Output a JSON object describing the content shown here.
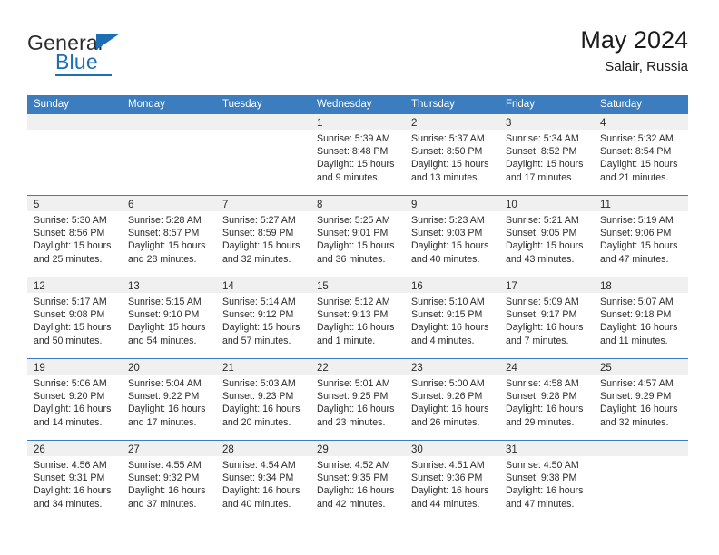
{
  "brand": {
    "name_top": "General",
    "name_bottom": "Blue",
    "triangle_color": "#1c6fb5"
  },
  "header": {
    "title": "May 2024",
    "subtitle": "Salair, Russia"
  },
  "theme": {
    "header_blue": "#3b7dbf",
    "daynum_band": "#f0f0f0",
    "text": "#2b2b2b"
  },
  "weekdays": [
    "Sunday",
    "Monday",
    "Tuesday",
    "Wednesday",
    "Thursday",
    "Friday",
    "Saturday"
  ],
  "labels": {
    "sunrise": "Sunrise:",
    "sunset": "Sunset:",
    "daylight": "Daylight:"
  },
  "weeks": [
    [
      {
        "day": "",
        "lines": []
      },
      {
        "day": "",
        "lines": []
      },
      {
        "day": "",
        "lines": []
      },
      {
        "day": "1",
        "lines": [
          "Sunrise: 5:39 AM",
          "Sunset: 8:48 PM",
          "Daylight: 15 hours and 9 minutes."
        ]
      },
      {
        "day": "2",
        "lines": [
          "Sunrise: 5:37 AM",
          "Sunset: 8:50 PM",
          "Daylight: 15 hours and 13 minutes."
        ]
      },
      {
        "day": "3",
        "lines": [
          "Sunrise: 5:34 AM",
          "Sunset: 8:52 PM",
          "Daylight: 15 hours and 17 minutes."
        ]
      },
      {
        "day": "4",
        "lines": [
          "Sunrise: 5:32 AM",
          "Sunset: 8:54 PM",
          "Daylight: 15 hours and 21 minutes."
        ]
      }
    ],
    [
      {
        "day": "5",
        "lines": [
          "Sunrise: 5:30 AM",
          "Sunset: 8:56 PM",
          "Daylight: 15 hours and 25 minutes."
        ]
      },
      {
        "day": "6",
        "lines": [
          "Sunrise: 5:28 AM",
          "Sunset: 8:57 PM",
          "Daylight: 15 hours and 28 minutes."
        ]
      },
      {
        "day": "7",
        "lines": [
          "Sunrise: 5:27 AM",
          "Sunset: 8:59 PM",
          "Daylight: 15 hours and 32 minutes."
        ]
      },
      {
        "day": "8",
        "lines": [
          "Sunrise: 5:25 AM",
          "Sunset: 9:01 PM",
          "Daylight: 15 hours and 36 minutes."
        ]
      },
      {
        "day": "9",
        "lines": [
          "Sunrise: 5:23 AM",
          "Sunset: 9:03 PM",
          "Daylight: 15 hours and 40 minutes."
        ]
      },
      {
        "day": "10",
        "lines": [
          "Sunrise: 5:21 AM",
          "Sunset: 9:05 PM",
          "Daylight: 15 hours and 43 minutes."
        ]
      },
      {
        "day": "11",
        "lines": [
          "Sunrise: 5:19 AM",
          "Sunset: 9:06 PM",
          "Daylight: 15 hours and 47 minutes."
        ]
      }
    ],
    [
      {
        "day": "12",
        "lines": [
          "Sunrise: 5:17 AM",
          "Sunset: 9:08 PM",
          "Daylight: 15 hours and 50 minutes."
        ]
      },
      {
        "day": "13",
        "lines": [
          "Sunrise: 5:15 AM",
          "Sunset: 9:10 PM",
          "Daylight: 15 hours and 54 minutes."
        ]
      },
      {
        "day": "14",
        "lines": [
          "Sunrise: 5:14 AM",
          "Sunset: 9:12 PM",
          "Daylight: 15 hours and 57 minutes."
        ]
      },
      {
        "day": "15",
        "lines": [
          "Sunrise: 5:12 AM",
          "Sunset: 9:13 PM",
          "Daylight: 16 hours and 1 minute."
        ]
      },
      {
        "day": "16",
        "lines": [
          "Sunrise: 5:10 AM",
          "Sunset: 9:15 PM",
          "Daylight: 16 hours and 4 minutes."
        ]
      },
      {
        "day": "17",
        "lines": [
          "Sunrise: 5:09 AM",
          "Sunset: 9:17 PM",
          "Daylight: 16 hours and 7 minutes."
        ]
      },
      {
        "day": "18",
        "lines": [
          "Sunrise: 5:07 AM",
          "Sunset: 9:18 PM",
          "Daylight: 16 hours and 11 minutes."
        ]
      }
    ],
    [
      {
        "day": "19",
        "lines": [
          "Sunrise: 5:06 AM",
          "Sunset: 9:20 PM",
          "Daylight: 16 hours and 14 minutes."
        ]
      },
      {
        "day": "20",
        "lines": [
          "Sunrise: 5:04 AM",
          "Sunset: 9:22 PM",
          "Daylight: 16 hours and 17 minutes."
        ]
      },
      {
        "day": "21",
        "lines": [
          "Sunrise: 5:03 AM",
          "Sunset: 9:23 PM",
          "Daylight: 16 hours and 20 minutes."
        ]
      },
      {
        "day": "22",
        "lines": [
          "Sunrise: 5:01 AM",
          "Sunset: 9:25 PM",
          "Daylight: 16 hours and 23 minutes."
        ]
      },
      {
        "day": "23",
        "lines": [
          "Sunrise: 5:00 AM",
          "Sunset: 9:26 PM",
          "Daylight: 16 hours and 26 minutes."
        ]
      },
      {
        "day": "24",
        "lines": [
          "Sunrise: 4:58 AM",
          "Sunset: 9:28 PM",
          "Daylight: 16 hours and 29 minutes."
        ]
      },
      {
        "day": "25",
        "lines": [
          "Sunrise: 4:57 AM",
          "Sunset: 9:29 PM",
          "Daylight: 16 hours and 32 minutes."
        ]
      }
    ],
    [
      {
        "day": "26",
        "lines": [
          "Sunrise: 4:56 AM",
          "Sunset: 9:31 PM",
          "Daylight: 16 hours and 34 minutes."
        ]
      },
      {
        "day": "27",
        "lines": [
          "Sunrise: 4:55 AM",
          "Sunset: 9:32 PM",
          "Daylight: 16 hours and 37 minutes."
        ]
      },
      {
        "day": "28",
        "lines": [
          "Sunrise: 4:54 AM",
          "Sunset: 9:34 PM",
          "Daylight: 16 hours and 40 minutes."
        ]
      },
      {
        "day": "29",
        "lines": [
          "Sunrise: 4:52 AM",
          "Sunset: 9:35 PM",
          "Daylight: 16 hours and 42 minutes."
        ]
      },
      {
        "day": "30",
        "lines": [
          "Sunrise: 4:51 AM",
          "Sunset: 9:36 PM",
          "Daylight: 16 hours and 44 minutes."
        ]
      },
      {
        "day": "31",
        "lines": [
          "Sunrise: 4:50 AM",
          "Sunset: 9:38 PM",
          "Daylight: 16 hours and 47 minutes."
        ]
      },
      {
        "day": "",
        "lines": []
      }
    ]
  ]
}
